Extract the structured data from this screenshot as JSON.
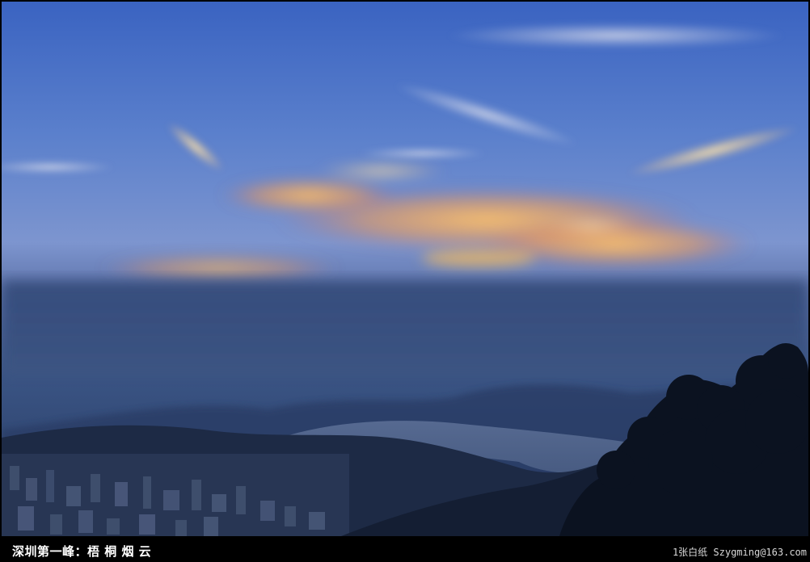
{
  "caption": {
    "title": "深圳第一峰：梧 桐 烟 云",
    "credit": "1张白纸 Szygming@163.com"
  },
  "colors": {
    "sky_top": "#3c66c4",
    "sky_mid": "#6f8fd2",
    "sky_low": "#8596c8",
    "haze": "#324a78",
    "mountain": "#1d2a45",
    "trees": "#0c1422",
    "cloud_glow": "#ffb357",
    "cloud_light": "#fde0a4",
    "bar": "#000000"
  }
}
